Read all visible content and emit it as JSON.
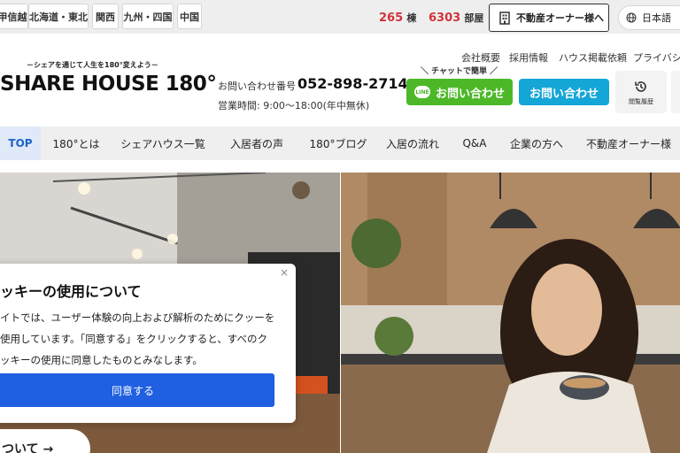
{
  "topbar": {
    "regions": [
      "甲信越",
      "北海道・東北",
      "関西",
      "九州・四国",
      "中国"
    ],
    "buildings_count": "265",
    "buildings_unit": "棟",
    "rooms_count": "6303",
    "rooms_unit": "部屋",
    "owner_button": "不動産オーナー様へ",
    "language": "日本語"
  },
  "header": {
    "tagline": "－シェアを通じて人生を180°変えよう－",
    "logo": "SHARE HOUSE 180°",
    "phone_label": "お問い合わせ番号",
    "phone_number": "052-898-2714",
    "hours": "営業時間: 9:00〜18:00(年中無休)",
    "util_links": [
      "会社概要",
      "採用情報",
      "ハウス掲載依頼",
      "プライバシ"
    ],
    "chat_note": "＼ チャットで簡単 ／",
    "line_badge": "LINE",
    "line_contact": "お問い合わせ",
    "mail_contact": "お問い合わせ",
    "history": "閲覧履歴"
  },
  "nav": {
    "items": [
      "TOP",
      "180°とは",
      "シェアハウス一覧",
      "入居者の声",
      "180°ブログ",
      "入居の流れ",
      "Q&A",
      "企業の方へ",
      "不動産オーナー様"
    ]
  },
  "cookie": {
    "title": "ッキーの使用について",
    "text": "イトでは、ユーザー体験の向上および解析のためにクッーを使用しています。「同意する」をクリックすると、すべのクッキーの使用に同意したものとみなします。",
    "accept": "同意する",
    "close": "×"
  },
  "hero": {
    "about_pill": "ついて →"
  },
  "colors": {
    "accent_red": "#d0333a",
    "line_green": "#4cb828",
    "mail_blue": "#14a6d6",
    "nav_active": "#1c63c8",
    "accept_blue": "#1f5fe0"
  }
}
